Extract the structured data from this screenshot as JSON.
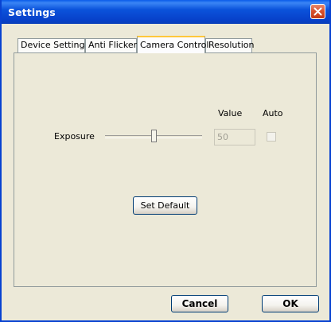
{
  "window": {
    "title": "Settings"
  },
  "tabs": [
    {
      "label": "Device Settings"
    },
    {
      "label": "Anti Flicker"
    },
    {
      "label": "Camera Control",
      "active": true
    },
    {
      "label": "Resolution"
    }
  ],
  "camera_control": {
    "value_header": "Value",
    "auto_header": "Auto",
    "exposure": {
      "label": "Exposure",
      "value": "50",
      "auto_checked": false,
      "slider_level": 0.5
    },
    "set_default_label": "Set Default"
  },
  "footer": {
    "cancel_label": "Cancel",
    "ok_label": "OK"
  },
  "icons": {
    "close": "close-icon"
  }
}
